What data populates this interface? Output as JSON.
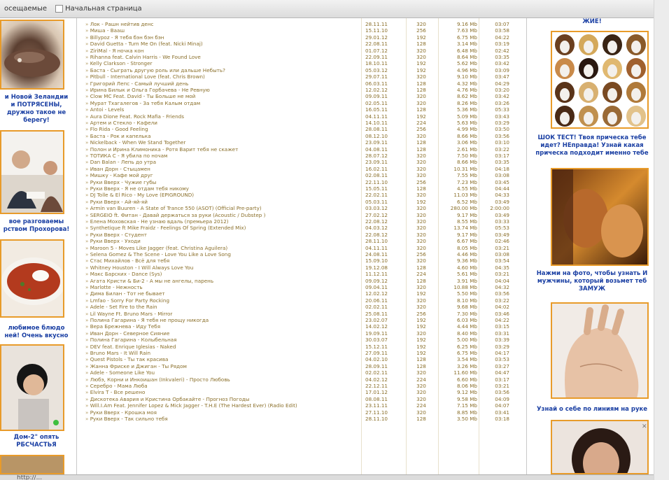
{
  "bookmarks": {
    "left_label": "осещаемые",
    "home_label": "Начальная страница"
  },
  "left_ads": [
    {
      "caption": "и Новой Зеландии\nи ПОТРЯСЕНЫ,\nдружно такое не\nберегу!"
    },
    {
      "caption": "вое разговаемы\nрством Прохорова!"
    },
    {
      "caption": "любимое блюдо\nней! Очень вкусно"
    },
    {
      "caption": "Дом-2\" опять\nРБСЧАСТЬЯ"
    }
  ],
  "right_ads": [
    {
      "caption": "ЖИЕ!"
    },
    {
      "caption": "ШОК ТЕСТ! Твоя прическа тебе\nидет? НЕправда! Узнай какая\nприческа подходит именно тебе"
    },
    {
      "caption": "Нажми на фото, чтобы узнать И\nмужчины, который возьмет теб\nЗАМУЖ"
    },
    {
      "caption": "Узнай о себе по линиям на руке"
    }
  ],
  "songs": [
    {
      "t": "Лок - Рашн нейтив денс",
      "d": "28.11.11",
      "b": "320",
      "s": "9.16 Mb",
      "l": "03:07"
    },
    {
      "t": "Миша - Вааш",
      "d": "15.11.10",
      "b": "256",
      "s": "7.63 Mb",
      "l": "03:58"
    },
    {
      "t": "Billypoz - Я тебя бэн бэн бэн",
      "d": "29.01.12",
      "b": "192",
      "s": "6.75 Mb",
      "l": "04:22"
    },
    {
      "t": "David Guetta - Turn Me On (feat. Nicki Minaj)",
      "d": "22.08.11",
      "b": "128",
      "s": "3.14 Mb",
      "l": "03:19"
    },
    {
      "t": "ZiriMal - Я ночка кон",
      "d": "01.07.12",
      "b": "320",
      "s": "6.48 Mb",
      "l": "02:42"
    },
    {
      "t": "Rihanna feat. Calvin Harris - We Found Love",
      "d": "22.09.11",
      "b": "320",
      "s": "8.64 Mb",
      "l": "03:35"
    },
    {
      "t": "Kelly Clarkson - Stronger",
      "d": "18.10.11",
      "b": "192",
      "s": "5.62 Mb",
      "l": "03:42"
    },
    {
      "t": "Баста - Сыграть другую роль или дальше Небыть?",
      "d": "05.03.12",
      "b": "192",
      "s": "4.96 Mb",
      "l": "03:09"
    },
    {
      "t": "Pitbull - International Love (feat. Chris Brown)",
      "d": "29.07.11",
      "b": "320",
      "s": "9.10 Mb",
      "l": "03:47"
    },
    {
      "t": "Григорий Лепс - Самый лучший день",
      "d": "06.03.11",
      "b": "128",
      "s": "4.32 Mb",
      "l": "04:29"
    },
    {
      "t": "Ирина Билык и Ольга Горбачева - Не Ревную",
      "d": "12.02.12",
      "b": "128",
      "s": "4.76 Mb",
      "l": "03:20"
    },
    {
      "t": "Clow МС Feat. David - Ты Больше не мой",
      "d": "09.09.11",
      "b": "320",
      "s": "8.62 Mb",
      "l": "03:42"
    },
    {
      "t": "Мурат Тхагалегов - За тебя Калым отдам",
      "d": "02.05.11",
      "b": "320",
      "s": "8.26 Mb",
      "l": "03:26"
    },
    {
      "t": "Antoi - Levels",
      "d": "16.05.11",
      "b": "128",
      "s": "5.36 Mb",
      "l": "05:33"
    },
    {
      "t": "Aura Dione Feat. Rock Mafia - Friends",
      "d": "04.11.11",
      "b": "192",
      "s": "5.09 Mb",
      "l": "03:43"
    },
    {
      "t": "Артем и Стекло - Кафели",
      "d": "14.10.11",
      "b": "224",
      "s": "5.63 Mb",
      "l": "03:29"
    },
    {
      "t": "Flo Rida - Good Feeling",
      "d": "28.08.11",
      "b": "256",
      "s": "4.99 Mb",
      "l": "03:50"
    },
    {
      "t": "Баста - Рок и капелька",
      "d": "08.12.10",
      "b": "320",
      "s": "8.66 Mb",
      "l": "03:56"
    },
    {
      "t": "Nickelback - When We Stand Together",
      "d": "23.09.11",
      "b": "128",
      "s": "3.06 Mb",
      "l": "03:10"
    },
    {
      "t": "Полон и Ирина Климоника - Ротя Варит тебя не скажет",
      "d": "04.08.11",
      "b": "128",
      "s": "2.61 Mb",
      "l": "03:22"
    },
    {
      "t": "ТОТИКА С - Я убила по ночам",
      "d": "28.07.12",
      "b": "320",
      "s": "7.50 Mb",
      "l": "03:17"
    },
    {
      "t": "Dan Balan - Лепь до утра",
      "d": "23.09.11",
      "b": "320",
      "s": "8.66 Mb",
      "l": "03:35"
    },
    {
      "t": "Иван Дорн - Стыцамен",
      "d": "16.02.11",
      "b": "320",
      "s": "10.31 Mb",
      "l": "04:18"
    },
    {
      "t": "Мишку - Кафе мой друг",
      "d": "02.08.11",
      "b": "320",
      "s": "7.55 Mb",
      "l": "03:08"
    },
    {
      "t": "Руки Вверх - Чужие губы",
      "d": "22.11.10",
      "b": "256",
      "s": "7.23 Mb",
      "l": "03:45"
    },
    {
      "t": "Руки Вверх - Я не отдам тебя никому",
      "d": "15.05.11",
      "b": "128",
      "s": "4.55 Mb",
      "l": "04:44"
    },
    {
      "t": "DJ Tolle & El Rico - My Love (EPIGROUND)",
      "d": "22.02.11",
      "b": "320",
      "s": "11.03 Mb",
      "l": "04:33"
    },
    {
      "t": "Руки Вверх - Ай-яй-яй",
      "d": "05.03.11",
      "b": "192",
      "s": "6.52 Mb",
      "l": "03:49"
    },
    {
      "t": "Armin van Buuren - A State of Trance 550 (ASOT) (Official Pre-party)",
      "d": "03.03.12",
      "b": "320",
      "s": "280.00 Mb",
      "l": "2:00:00"
    },
    {
      "t": "SERGEIO ft. Фитан - Давай держаться за руки (Acoustic / Dubstep )",
      "d": "27.02.12",
      "b": "320",
      "s": "9.17 Mb",
      "l": "03:49"
    },
    {
      "t": "Елена Моховская - Не узнаю вдаль (премьера 2012)",
      "d": "22.08.12",
      "b": "320",
      "s": "8.55 Mb",
      "l": "03:33"
    },
    {
      "t": "Synthetique ft Mike Fraidz - Feelings Of Spring (Extended Mix)",
      "d": "04.03.12",
      "b": "320",
      "s": "13.74 Mb",
      "l": "05:53"
    },
    {
      "t": "Руки Вверх - Студент",
      "d": "22.08.12",
      "b": "320",
      "s": "9.17 Mb",
      "l": "03:49"
    },
    {
      "t": "Руки Вверх - Уходи",
      "d": "28.11.10",
      "b": "320",
      "s": "6.67 Mb",
      "l": "02:46"
    },
    {
      "t": "Maroon 5 - Moves Like Jagger (feat. Christina Aguilera)",
      "d": "04.11.11",
      "b": "320",
      "s": "8.05 Mb",
      "l": "03:21"
    },
    {
      "t": "Selena Gomez & The Scene - Love You Like a Love Song",
      "d": "24.08.11",
      "b": "256",
      "s": "4.46 Mb",
      "l": "03:08"
    },
    {
      "t": "Стас Михайлов - Всё для тебя",
      "d": "15.09.10",
      "b": "320",
      "s": "9.36 Mb",
      "l": "03:54"
    },
    {
      "t": "Whitney Houston - I Will Always Love You",
      "d": "19.12.08",
      "b": "128",
      "s": "4.60 Mb",
      "l": "04:35"
    },
    {
      "t": "Макс Барских - Dance (Sys)",
      "d": "11.12.11",
      "b": "224",
      "s": "5.61 Mb",
      "l": "03:21"
    },
    {
      "t": "Агата Кристи & Би-2 - А мы не ангелы, парень",
      "d": "09.09.12",
      "b": "128",
      "s": "3.91 Mb",
      "l": "04:04"
    },
    {
      "t": "Marlotte - Нежность",
      "d": "09.04.11",
      "b": "320",
      "s": "10.88 Mb",
      "l": "04:32"
    },
    {
      "t": "Дима Билан - Тот не бывает",
      "d": "12.02.12",
      "b": "192",
      "s": "5.50 Mb",
      "l": "03:56"
    },
    {
      "t": "Lmfao - Sorry For Party Rocking",
      "d": "20.06.11",
      "b": "320",
      "s": "8.10 Mb",
      "l": "03:22"
    },
    {
      "t": "Adele - Set Fire to the Rain",
      "d": "02.02.11",
      "b": "320",
      "s": "9.68 Mb",
      "l": "04:02"
    },
    {
      "t": "Lil Wayne Ft. Bruno Mars - Mirror",
      "d": "25.08.11",
      "b": "256",
      "s": "7.30 Mb",
      "l": "03:46"
    },
    {
      "t": "Полина Гагарина - Я тебя не прощу никогда",
      "d": "23.02.07",
      "b": "192",
      "s": "6.03 Mb",
      "l": "04:22"
    },
    {
      "t": "Вера Брежнева - Иду Тебя",
      "d": "14.02.12",
      "b": "192",
      "s": "4.44 Mb",
      "l": "03:15"
    },
    {
      "t": "Иван Дорн - Северное Сияние",
      "d": "19.09.11",
      "b": "320",
      "s": "8.40 Mb",
      "l": "03:31"
    },
    {
      "t": "Полина Гагарина - Колыбельная",
      "d": "30.03.07",
      "b": "192",
      "s": "5.00 Mb",
      "l": "03:39"
    },
    {
      "t": "DEV feat. Enrique Iglesias - Naked",
      "d": "15.12.11",
      "b": "192",
      "s": "6.25 Mb",
      "l": "03:29"
    },
    {
      "t": "Bruno Mars - It Will Rain",
      "d": "27.09.11",
      "b": "192",
      "s": "6.75 Mb",
      "l": "04:17"
    },
    {
      "t": "Quest Pistols - Ты так красива",
      "d": "04.02.10",
      "b": "128",
      "s": "3.54 Mb",
      "l": "03:53"
    },
    {
      "t": "Жанна Фриске и Джиган - Ты Рядом",
      "d": "28.09.11",
      "b": "128",
      "s": "3.26 Mb",
      "l": "03:27"
    },
    {
      "t": "Adele - Someone Like You",
      "d": "02.02.11",
      "b": "320",
      "s": "11.60 Mb",
      "l": "04:47"
    },
    {
      "t": "Любэ, Корни и Инкоишан (Inkvaleri) - Просто Любовь",
      "d": "04.02.12",
      "b": "224",
      "s": "6.60 Mb",
      "l": "03:17"
    },
    {
      "t": "Серебро - Мама Люба",
      "d": "22.12.11",
      "b": "320",
      "s": "8.06 Mb",
      "l": "03:21"
    },
    {
      "t": "Elvira T - Все решено",
      "d": "17.01.12",
      "b": "320",
      "s": "9.12 Mb",
      "l": "03:56"
    },
    {
      "t": "Дискотека Авария и Кристина Орбакайте - Прогноз Погоды",
      "d": "08.08.11",
      "b": "320",
      "s": "9.58 Mb",
      "l": "04:09"
    },
    {
      "t": "Will.I.Am Feat. Jennifer Lopez & Mick Jagger - T.H.E (The Hardest Ever) (Radio Edit)",
      "d": "23.11.11",
      "b": "224",
      "s": "7.15 Mb",
      "l": "04:07"
    },
    {
      "t": "Руки Вверх - Крошка моя",
      "d": "27.11.10",
      "b": "320",
      "s": "8.85 Mb",
      "l": "03:41"
    },
    {
      "t": "Руки Вверх - Так сильно тебя",
      "d": "28.11.10",
      "b": "128",
      "s": "3.50 Mb",
      "l": "03:18"
    }
  ],
  "status": {
    "url": "http://..."
  },
  "colors": {
    "ad_border": "#e89b2a",
    "caption": "#1a3fa3",
    "row_text": "#8a6f2a"
  }
}
